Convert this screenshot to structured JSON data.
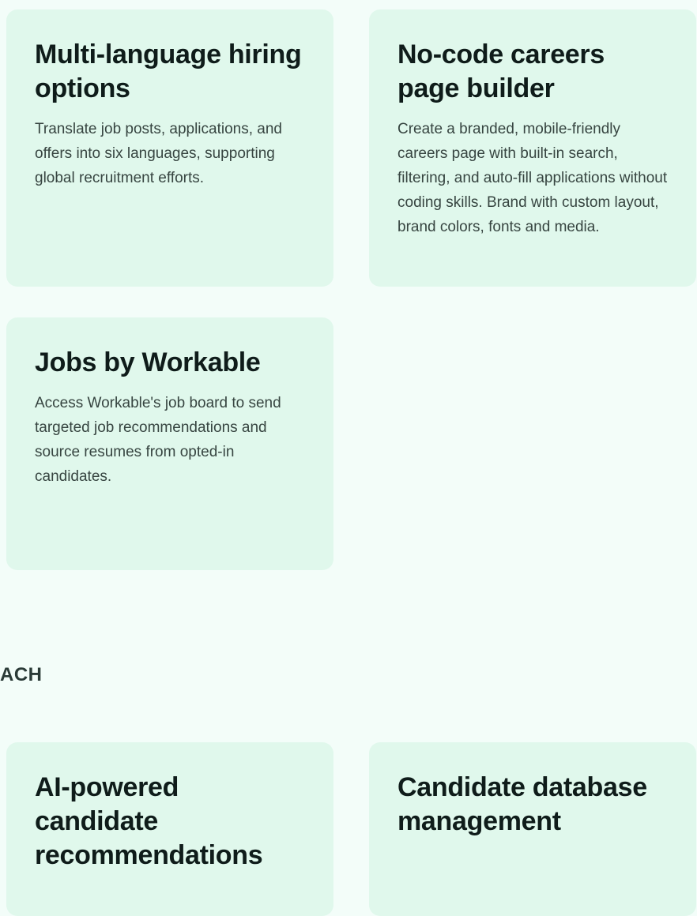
{
  "section_label": "ACH",
  "cards": [
    {
      "title": "Multi-language hiring options",
      "description": "Translate job posts, applications, and offers into six languages, supporting global recruitment efforts."
    },
    {
      "title": "No-code careers page builder",
      "description": "Create a branded, mobile-friendly careers page with built-in search, filtering, and auto-fill applications without coding skills. Brand with custom layout, brand colors, fonts and media."
    },
    {
      "title": "Jobs by Workable",
      "description": "Access Workable's job board to send targeted job recommendations and source resumes from opted-in candidates."
    },
    {
      "title": "AI-powered candidate recommendations",
      "description": ""
    },
    {
      "title": "Candidate database management",
      "description": ""
    }
  ],
  "colors": {
    "page_background": "#f3fdf9",
    "card_background": "#e0f8ec",
    "title_text": "#0f1c1a",
    "body_text": "#374541"
  }
}
